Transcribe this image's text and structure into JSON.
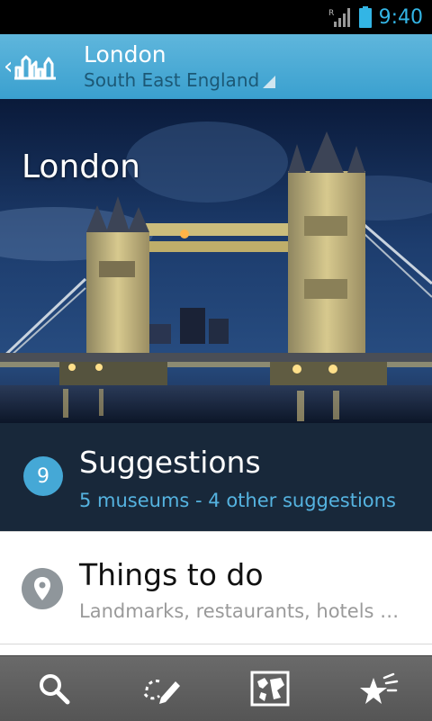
{
  "status_bar": {
    "time": "9:40",
    "roaming": "R"
  },
  "app_bar": {
    "title": "London",
    "subtitle": "South East England"
  },
  "hero": {
    "title": "London"
  },
  "suggestions": {
    "count": "9",
    "title": "Suggestions",
    "subtitle": "5 museums - 4 other suggestions"
  },
  "things_to_do": {
    "title": "Things to do",
    "subtitle": "Landmarks, restaurants, hotels …"
  },
  "bottom_bar": {
    "items": [
      "search-icon",
      "edit-icon",
      "map-icon",
      "stars-icon"
    ]
  },
  "colors": {
    "accent": "#33b5e5",
    "app_bar": "#4aaad6",
    "suggestions_bg": "#18283a",
    "badge": "#45a8d6"
  }
}
